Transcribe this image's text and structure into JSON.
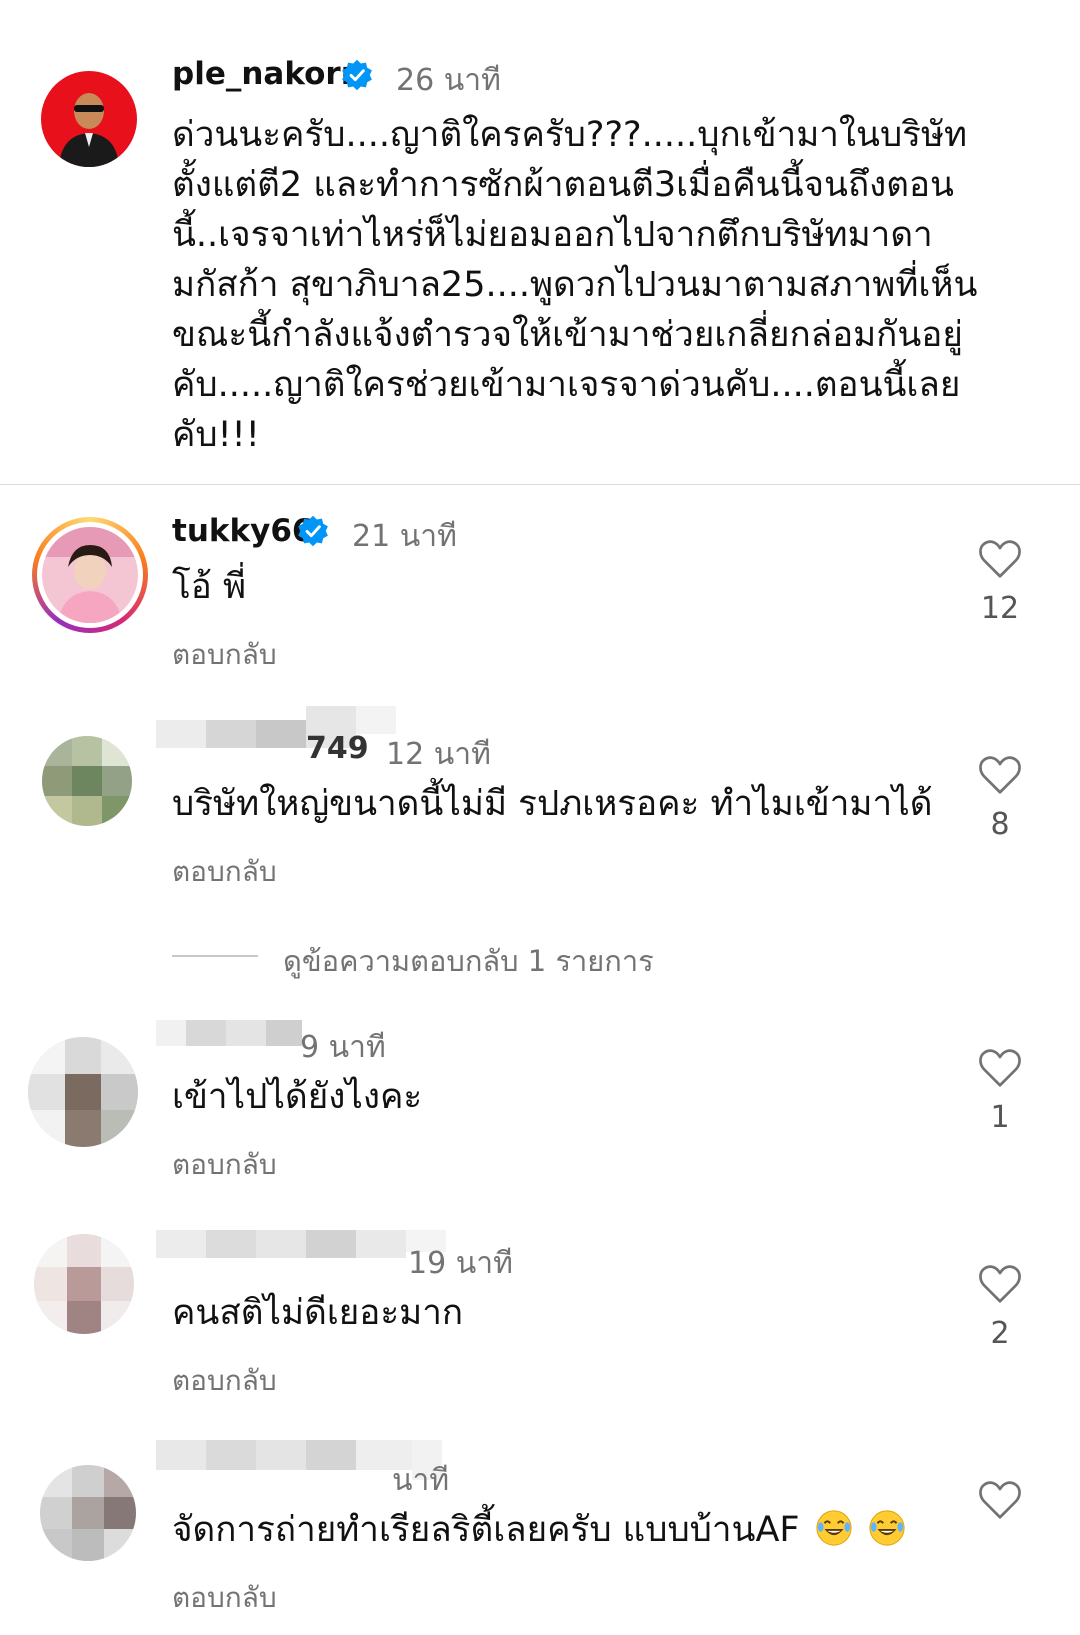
{
  "post": {
    "username": "ple_nakorn",
    "time": "26 นาที",
    "lines": [
      "ด่วนนะครับ....ญาติใครครับ???.....บุกเข้ามาในบริษัท",
      "ตั้งแต่ตี2 และทำการซักผ้าตอนตี3เมื่อคืนนี้จนถึงตอน",
      "นี้..เจรจาเท่าไหร่ห็ไม่ยอมออกไปจากตึกบริษัทมาดา",
      "มกัสก้า สุขาภิบาล25....พูดวกไปวนมาตามสภาพที่เห็น",
      "ขณะนี้กำลังแจ้งตำรวจให้เข้ามาช่วยเกลี่ยกล่อมกันอยู่",
      "คับ.....ญาติใครช่วยเข้ามาเจรจาด่วนคับ....ตอนนี้เลย",
      "คับ!!!"
    ]
  },
  "comments": [
    {
      "username": "tukky66",
      "time": "21 นาที",
      "text": "โอ้ พี่",
      "reply": "ตอบกลับ",
      "likes": "12"
    },
    {
      "username_partial": "749",
      "time": "12 นาที",
      "text": "บริษัทใหญ่ขนาดนี้ไม่มี รปภเหรอคะ ทำไมเข้ามาได้",
      "reply": "ตอบกลับ",
      "likes": "8"
    },
    {
      "time": "9 นาที",
      "text": "เข้าไปได้ยังไงคะ",
      "reply": "ตอบกลับ",
      "likes": "1"
    },
    {
      "time": "19 นาที",
      "text": "คนสติไม่ดีเยอะมาก",
      "reply": "ตอบกลับ",
      "likes": "2"
    },
    {
      "time": "นาที",
      "text": "จัดการถ่ายทำเรียลริตี้เลยครับ แบบบ้านAF",
      "reply": "ตอบกลับ",
      "likes": ""
    }
  ],
  "view_replies": "ดูข้อความตอบกลับ 1 รายการ",
  "colors": {
    "verified": "#0095f6",
    "muted": "#737373",
    "text": "#111111",
    "divider": "#dbdbdb"
  },
  "icons": [
    "verified-badge-icon",
    "heart-icon",
    "laughing-emoji-icon"
  ]
}
